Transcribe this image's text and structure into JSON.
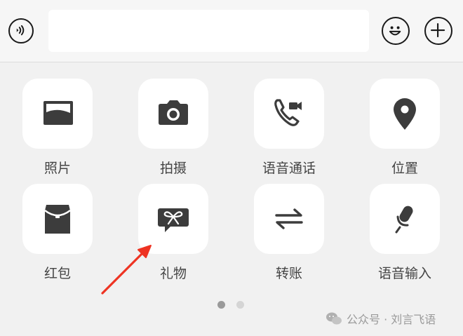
{
  "input": {
    "value": "",
    "placeholder": ""
  },
  "panel": {
    "items": [
      {
        "label": "照片",
        "icon": "photo-icon"
      },
      {
        "label": "拍摄",
        "icon": "camera-icon"
      },
      {
        "label": "语音通话",
        "icon": "call-video-icon"
      },
      {
        "label": "位置",
        "icon": "location-pin-icon"
      },
      {
        "label": "红包",
        "icon": "red-packet-icon"
      },
      {
        "label": "礼物",
        "icon": "gift-icon"
      },
      {
        "label": "转账",
        "icon": "transfer-icon"
      },
      {
        "label": "语音输入",
        "icon": "microphone-icon"
      }
    ]
  },
  "pager": {
    "pages": 2,
    "current": 1
  },
  "watermark": {
    "text": "公众号 · 刘言飞语"
  },
  "colors": {
    "icon": "#3c3c3c",
    "annotation_arrow": "#ee3322",
    "tile": "#ffffff",
    "panel_bg": "#f1f1f1"
  }
}
